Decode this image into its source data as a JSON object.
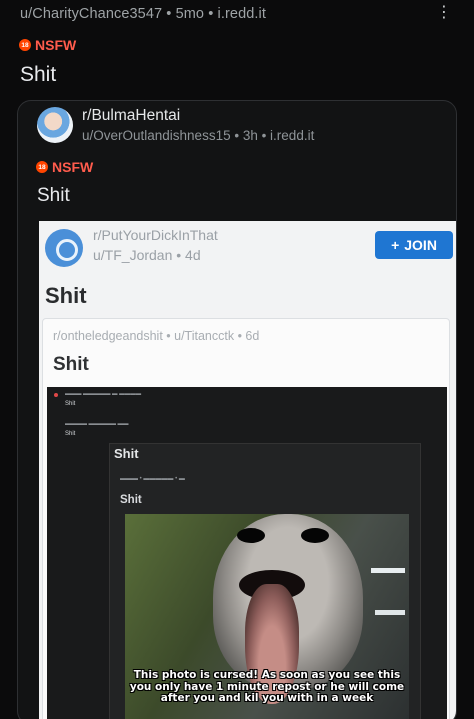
{
  "post": {
    "meta": "u/CharityChance3547 • 5mo • i.redd.it",
    "nsfw_label": "NSFW",
    "nsfw_badge": "18",
    "title": "Shit",
    "more_icon": "vertical-ellipsis"
  },
  "crosspost": {
    "subreddit": "r/BulmaHentai",
    "meta": "u/OverOutlandishness15 • 3h • i.redd.it",
    "nsfw_label": "NSFW",
    "nsfw_badge": "18",
    "title": "Shit"
  },
  "screenshot": {
    "subreddit": "r/PutYourDickInThat",
    "user": "u/TF_Jordan • 4d",
    "join_label": "JOIN",
    "join_icon": "+",
    "title": "Shit",
    "inner_meta": "r/ontheledgeandshit • u/Titancctk • 6d",
    "inner_title": "Shit",
    "dark_line1": "Shit",
    "dark_line2": "Shit",
    "card_title": "Shit",
    "card_title2": "Shit",
    "photo_caption": "This photo is cursed! As soon as you see this you only have 1 minute repost or he will come after you and kil you with in a week"
  },
  "colors": {
    "background": "#0b0b0c",
    "nsfw": "#ff4500",
    "join_button": "#1f76d2"
  }
}
